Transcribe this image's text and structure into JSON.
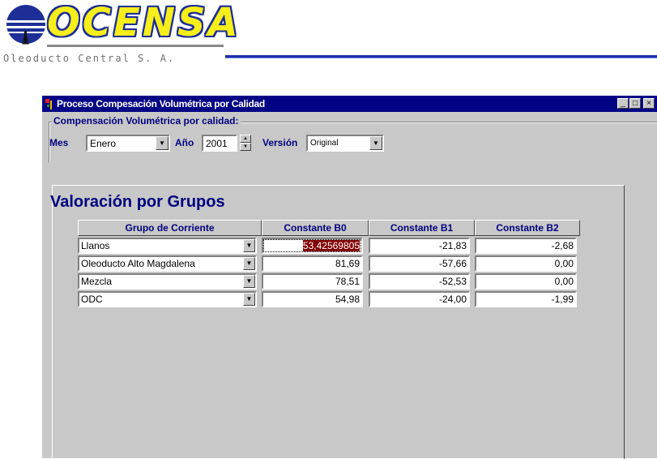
{
  "logo": {
    "wordmark": "OCENSA",
    "subtitle": "Oleoducto Central S. A."
  },
  "window": {
    "title": "Proceso Compesación Volumétrica por Calidad",
    "controls": {
      "minimize": "_",
      "maximize": "□",
      "close": "×"
    }
  },
  "filters": {
    "group_label": "Compensación Volumétrica por calidad:",
    "mes_label": "Mes",
    "mes_value": "Enero",
    "anio_label": "Año",
    "anio_value": "2001",
    "version_label": "Versión",
    "version_value": "Original"
  },
  "panel": {
    "title": "Valoración por Grupos",
    "columns": [
      "Grupo de Corriente",
      "Constante B0",
      "Constante B1",
      "Constante B2"
    ],
    "rows": [
      {
        "grupo": "Llanos",
        "b0": "53,42569805",
        "b1": "-21,83",
        "b2": "-2,68"
      },
      {
        "grupo": "Oleoducto Alto Magdalena",
        "b0": "81,69",
        "b1": "-57,66",
        "b2": "0,00"
      },
      {
        "grupo": "Mezcla",
        "b0": "78,51",
        "b1": "-52,53",
        "b2": "0,00"
      },
      {
        "grupo": "ODC",
        "b0": "54,98",
        "b1": "-24,00",
        "b2": "-1,99"
      }
    ]
  },
  "colors": {
    "titlebar": "#020285",
    "label_blue": "#000080",
    "selection": "#800000",
    "logo_yellow": "#f7ee1a",
    "logo_blue": "#1d2f96"
  }
}
